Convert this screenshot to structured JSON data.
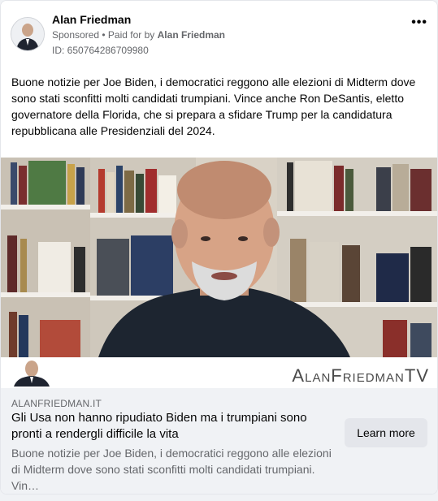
{
  "post": {
    "author": "Alan Friedman",
    "sponsored": "Sponsored",
    "paid_prefix": "• Paid for by",
    "paid_name": "Alan Friedman",
    "ad_id": "ID: 650764286709980",
    "more_icon": "more-horizontal-icon",
    "more_label": "•••",
    "text": "Buone notizie per Joe Biden, i democratici reggono alle elezioni di Midterm dove sono stati sconfitti molti candidati trumpiani. Vince anche Ron DeSantis, eletto governatore della Florida, che si prepara a sfidare Trump per la candidatura repubblicana alle Presidenziali del 2024."
  },
  "video": {
    "brand": "AlanFriedmanTV"
  },
  "link": {
    "domain": "ALANFRIEDMAN.IT",
    "headline": "Gli Usa non hanno ripudiato Biden ma i trumpiani sono pronti a rendergli difficile la vita",
    "description": "Buone notizie per Joe Biden, i democratici reggono alle elezioni di Midterm dove sono stati sconfitti molti candidati trumpiani. Vin…",
    "cta": "Learn more"
  },
  "colors": {
    "secondary_text": "#65676b",
    "button_bg": "#e4e6eb",
    "link_bg": "#f0f2f5"
  }
}
